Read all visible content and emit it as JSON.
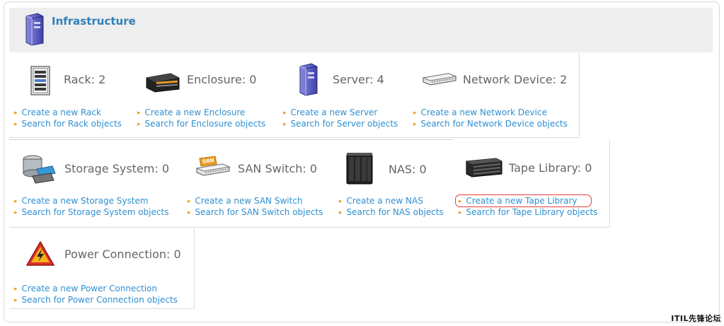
{
  "header": {
    "title": "Infrastructure"
  },
  "rows": [
    [
      {
        "id": "rack",
        "title": "Rack: 2",
        "icon": "rack-icon",
        "create": "Create a new Rack",
        "search": "Search for Rack objects"
      },
      {
        "id": "enclosure",
        "title": "Enclosure: 0",
        "icon": "enclosure-icon",
        "create": "Create a new Enclosure",
        "search": "Search for Enclosure objects"
      },
      {
        "id": "server",
        "title": "Server: 4",
        "icon": "server-icon",
        "create": "Create a new Server",
        "search": "Search for Server objects"
      },
      {
        "id": "network-device",
        "title": "Network Device: 2",
        "icon": "network-device-icon",
        "create": "Create a new Network Device",
        "search": "Search for Network Device objects"
      }
    ],
    [
      {
        "id": "storage-system",
        "title": "Storage System: 0",
        "icon": "storage-system-icon",
        "create": "Create a new Storage System",
        "search": "Search for Storage System objects"
      },
      {
        "id": "san-switch",
        "title": "SAN Switch: 0",
        "icon": "san-switch-icon",
        "create": "Create a new SAN Switch",
        "search": "Search for SAN Switch objects"
      },
      {
        "id": "nas",
        "title": "NAS: 0",
        "icon": "nas-icon",
        "create": "Create a new NAS",
        "search": "Search for NAS objects"
      },
      {
        "id": "tape-library",
        "title": "Tape Library: 0",
        "icon": "tape-library-icon",
        "create": "Create a new Tape Library",
        "search": "Search for Tape Library objects"
      }
    ],
    [
      {
        "id": "power-connection",
        "title": "Power Connection: 0",
        "icon": "power-connection-icon",
        "create": "Create a new Power Connection",
        "search": "Search for Power Connection objects"
      }
    ]
  ],
  "san_label": "SAN",
  "watermark": "ITIL先锋论坛",
  "colors": {
    "link": "#2f8fd1",
    "bullet": "#f09a1a",
    "title": "#2f7fb7",
    "highlight": "#e83b3b"
  }
}
